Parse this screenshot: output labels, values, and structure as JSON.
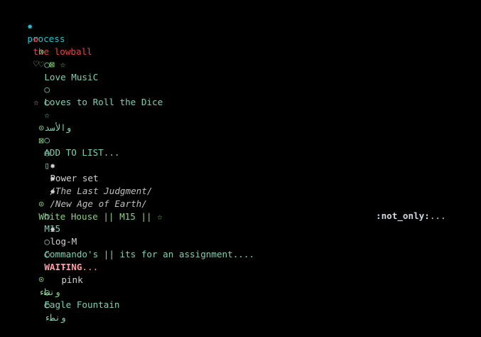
{
  "bullets": {
    "star6": "✸",
    "flower": "✿",
    "target": "⊙",
    "circle": "○",
    "dash": "-"
  },
  "colors": {
    "background": "#000000",
    "level0": "#22c3d6",
    "level1": "#e2493a",
    "level2": "#8ad17d",
    "level3": "#7fd1b0",
    "waiting": "#ff9ea4"
  },
  "outline": {
    "root": "process",
    "child": "the lowball",
    "g1_heading": "♡ ⊠ ☆",
    "g1_item1": "Love MusiC",
    "g1_item1_note": "♡",
    "g1_item2": "Loves to Roll the Dice",
    "g1_item3_star": "☆",
    "g1_item3_arabic": "والأسد",
    "g1_item3_note": "☆",
    "g2_heading": "⊠",
    "g2_item1": "ADD TO LIST...",
    "g2_item2": "▯",
    "g2_sub1": "Power set",
    "g2_sub2": "/The Last Judgment/",
    "g2_sub3": "/New Age of Earth/",
    "g3_heading": "White House || M15 || ☆",
    "g3_item1": "M15",
    "g3_sub1": "log-M",
    "g3_tag_key": ":not_only:",
    "g3_tag_rest": "...",
    "g3_item2": "Commando's || its for an assignment....",
    "g3_item3_bold": "WAITING",
    "g3_item3_rest": "...",
    "g3_item3_sub": "pink",
    "g4_heading": "ونطء",
    "g4_item1": "Eagle Fountain",
    "g4_item2": "ونطء"
  }
}
